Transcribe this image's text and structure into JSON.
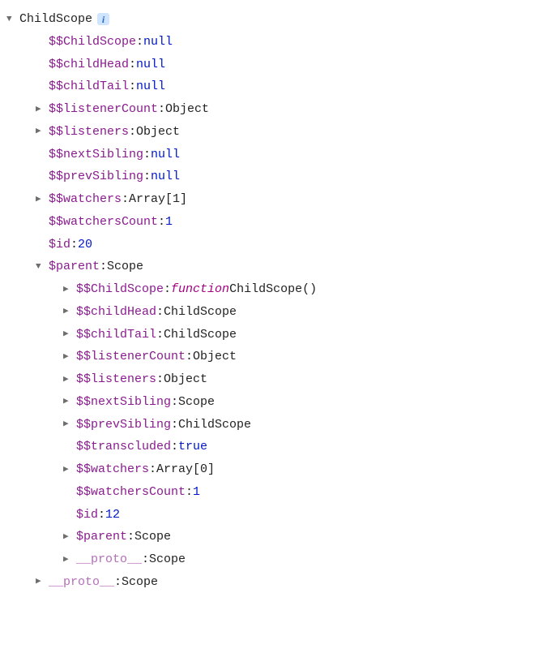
{
  "tree": [
    {
      "indent": 0,
      "expand": "open",
      "keyClass": "root-label",
      "key": "ChildScope",
      "sep": "",
      "valueClass": "",
      "value": "",
      "info": true
    },
    {
      "indent": 1,
      "expand": "none",
      "keyClass": "key",
      "key": "$$ChildScope",
      "sep": ": ",
      "valueClass": "val-null",
      "value": "null"
    },
    {
      "indent": 1,
      "expand": "none",
      "keyClass": "key",
      "key": "$$childHead",
      "sep": ": ",
      "valueClass": "val-null",
      "value": "null"
    },
    {
      "indent": 1,
      "expand": "none",
      "keyClass": "key",
      "key": "$$childTail",
      "sep": ": ",
      "valueClass": "val-null",
      "value": "null"
    },
    {
      "indent": 1,
      "expand": "closed",
      "keyClass": "key",
      "key": "$$listenerCount",
      "sep": ": ",
      "valueClass": "val-obj",
      "value": "Object"
    },
    {
      "indent": 1,
      "expand": "closed",
      "keyClass": "key",
      "key": "$$listeners",
      "sep": ": ",
      "valueClass": "val-obj",
      "value": "Object"
    },
    {
      "indent": 1,
      "expand": "none",
      "keyClass": "key",
      "key": "$$nextSibling",
      "sep": ": ",
      "valueClass": "val-null",
      "value": "null"
    },
    {
      "indent": 1,
      "expand": "none",
      "keyClass": "key",
      "key": "$$prevSibling",
      "sep": ": ",
      "valueClass": "val-null",
      "value": "null"
    },
    {
      "indent": 1,
      "expand": "closed",
      "keyClass": "key",
      "key": "$$watchers",
      "sep": ": ",
      "valueClass": "val-obj",
      "value": "Array[1]"
    },
    {
      "indent": 1,
      "expand": "none",
      "keyClass": "key",
      "key": "$$watchersCount",
      "sep": ": ",
      "valueClass": "val-num",
      "value": "1"
    },
    {
      "indent": 1,
      "expand": "none",
      "keyClass": "key",
      "key": "$id",
      "sep": ": ",
      "valueClass": "val-num",
      "value": "20"
    },
    {
      "indent": 1,
      "expand": "open",
      "keyClass": "key",
      "key": "$parent",
      "sep": ": ",
      "valueClass": "val-obj",
      "value": "Scope"
    },
    {
      "indent": 2,
      "expand": "closed",
      "keyClass": "key",
      "key": "$$ChildScope",
      "sep": ": ",
      "valueClass": "",
      "value": "",
      "fn": {
        "kw": "function",
        "name": " ChildScope()"
      }
    },
    {
      "indent": 2,
      "expand": "closed",
      "keyClass": "key",
      "key": "$$childHead",
      "sep": ": ",
      "valueClass": "val-obj",
      "value": "ChildScope"
    },
    {
      "indent": 2,
      "expand": "closed",
      "keyClass": "key",
      "key": "$$childTail",
      "sep": ": ",
      "valueClass": "val-obj",
      "value": "ChildScope"
    },
    {
      "indent": 2,
      "expand": "closed",
      "keyClass": "key",
      "key": "$$listenerCount",
      "sep": ": ",
      "valueClass": "val-obj",
      "value": "Object"
    },
    {
      "indent": 2,
      "expand": "closed",
      "keyClass": "key",
      "key": "$$listeners",
      "sep": ": ",
      "valueClass": "val-obj",
      "value": "Object"
    },
    {
      "indent": 2,
      "expand": "closed",
      "keyClass": "key",
      "key": "$$nextSibling",
      "sep": ": ",
      "valueClass": "val-obj",
      "value": "Scope"
    },
    {
      "indent": 2,
      "expand": "closed",
      "keyClass": "key",
      "key": "$$prevSibling",
      "sep": ": ",
      "valueClass": "val-obj",
      "value": "ChildScope"
    },
    {
      "indent": 2,
      "expand": "none",
      "keyClass": "key",
      "key": "$$transcluded",
      "sep": ": ",
      "valueClass": "val-bool",
      "value": "true"
    },
    {
      "indent": 2,
      "expand": "closed",
      "keyClass": "key",
      "key": "$$watchers",
      "sep": ": ",
      "valueClass": "val-obj",
      "value": "Array[0]"
    },
    {
      "indent": 2,
      "expand": "none",
      "keyClass": "key",
      "key": "$$watchersCount",
      "sep": ": ",
      "valueClass": "val-num",
      "value": "1"
    },
    {
      "indent": 2,
      "expand": "none",
      "keyClass": "key",
      "key": "$id",
      "sep": ": ",
      "valueClass": "val-num",
      "value": "12"
    },
    {
      "indent": 2,
      "expand": "closed",
      "keyClass": "key",
      "key": "$parent",
      "sep": ": ",
      "valueClass": "val-obj",
      "value": "Scope"
    },
    {
      "indent": 2,
      "expand": "closed",
      "keyClass": "proto",
      "key": "__proto__",
      "sep": ": ",
      "valueClass": "val-obj",
      "value": "Scope"
    },
    {
      "indent": 1,
      "expand": "closed",
      "keyClass": "proto",
      "key": "__proto__",
      "sep": ": ",
      "valueClass": "val-obj",
      "value": "Scope"
    }
  ],
  "glyphs": {
    "open": "▼",
    "closed": "▶",
    "none": "▶"
  },
  "infoGlyph": "i"
}
